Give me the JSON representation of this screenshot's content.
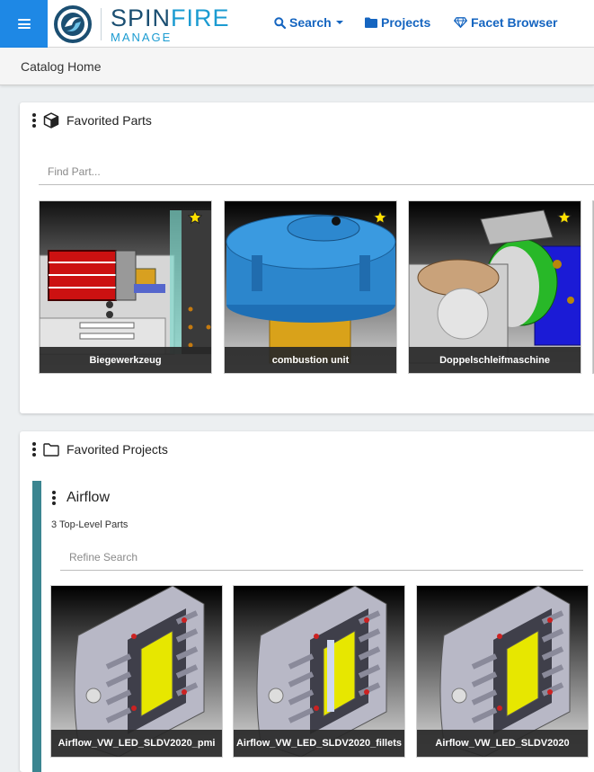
{
  "header": {
    "logo_primary": "SPIN",
    "logo_accent": "FIRE",
    "logo_sub": "MANAGE",
    "nav": {
      "search_label": "Search",
      "projects_label": "Projects",
      "facet_label": "Facet Browser"
    },
    "icons": {
      "menu": "hamburger-icon",
      "search": "search-icon",
      "projects": "folder-icon",
      "facet": "diamond-icon"
    }
  },
  "breadcrumb": {
    "label": "Catalog Home"
  },
  "favorited_parts": {
    "title": "Favorited Parts",
    "icon": "cube-icon",
    "search_placeholder": "Find Part...",
    "parts": [
      {
        "name": "Biegewerkzeug",
        "favorited": true
      },
      {
        "name": "combustion unit",
        "favorited": true
      },
      {
        "name": "Doppelschleifmaschine",
        "favorited": true
      }
    ]
  },
  "favorited_projects": {
    "title": "Favorited Projects",
    "icon": "folder-outline-icon",
    "project": {
      "name": "Airflow",
      "count_label": "3 Top-Level Parts",
      "search_placeholder": "Refine Search",
      "parts": [
        {
          "name": "Airflow_VW_LED_SLDV2020_pmi"
        },
        {
          "name": "Airflow_VW_LED_SLDV2020_fillets"
        },
        {
          "name": "Airflow_VW_LED_SLDV2020"
        }
      ]
    }
  },
  "colors": {
    "brand_blue": "#1e88e5",
    "nav_blue": "#1565c0",
    "project_accent": "#3b8590",
    "star": "#ffe000"
  }
}
